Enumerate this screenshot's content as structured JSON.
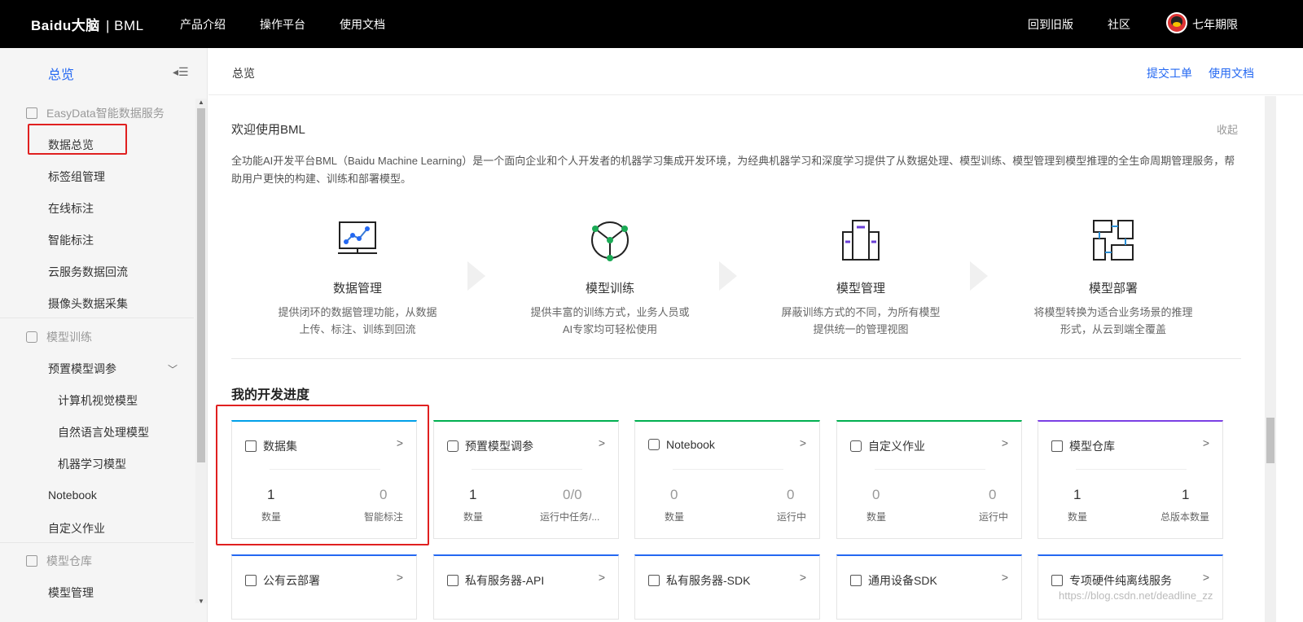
{
  "topbar": {
    "logo_text": "Bai",
    "logo_mid": "du大脑",
    "logo_bml": "| BML",
    "nav": [
      "产品介绍",
      "操作平台",
      "使用文档"
    ],
    "right": [
      "回到旧版",
      "社区"
    ],
    "username": "七年期限"
  },
  "sidebar": {
    "title": "总览",
    "collapse_glyph": "◂☰",
    "groups": {
      "easydata": "EasyData智能数据服务",
      "train": "模型训练",
      "repo": "模型仓库"
    },
    "items": {
      "data_overview": "数据总览",
      "tag_group": "标签组管理",
      "online_label": "在线标注",
      "smart_label": "智能标注",
      "cloud_return": "云服务数据回流",
      "camera": "摄像头数据采集",
      "preset_tune": "预置模型调参",
      "cv_model": "计算机视觉模型",
      "nlp_model": "自然语言处理模型",
      "ml_model": "机器学习模型",
      "notebook": "Notebook",
      "custom_job": "自定义作业",
      "model_mgmt": "模型管理"
    }
  },
  "header": {
    "breadcrumb": "总览",
    "submit_ticket": "提交工单",
    "docs": "使用文档"
  },
  "welcome": {
    "title": "欢迎使用BML",
    "collapse": "收起",
    "description": "全功能AI开发平台BML（Baidu Machine Learning）是一个面向企业和个人开发者的机器学习集成开发环境，为经典机器学习和深度学习提供了从数据处理、模型训练、模型管理到模型推理的全生命周期管理服务，帮助用户更快的构建、训练和部署模型。"
  },
  "features": [
    {
      "title": "数据管理",
      "desc1": "提供闭环的数据管理功能，从数据",
      "desc2": "上传、标注、训练到回流"
    },
    {
      "title": "模型训练",
      "desc1": "提供丰富的训练方式，业务人员或",
      "desc2": "AI专家均可轻松使用"
    },
    {
      "title": "模型管理",
      "desc1": "屏蔽训练方式的不同，为所有模型",
      "desc2": "提供统一的管理视图"
    },
    {
      "title": "模型部署",
      "desc1": "将模型转换为适合业务场景的推理",
      "desc2": "形式，从云到端全覆盖"
    }
  ],
  "progress": {
    "title": "我的开发进度",
    "cards": [
      {
        "name": "数据集",
        "v1": "1",
        "l1": "数量",
        "v2": "0",
        "l2": "智能标注"
      },
      {
        "name": "预置模型调参",
        "v1": "1",
        "l1": "数量",
        "v2": "0/0",
        "l2": "运行中任务/..."
      },
      {
        "name": "Notebook",
        "v1": "0",
        "l1": "数量",
        "v2": "0",
        "l2": "运行中"
      },
      {
        "name": "自定义作业",
        "v1": "0",
        "l1": "数量",
        "v2": "0",
        "l2": "运行中"
      },
      {
        "name": "模型仓库",
        "v1": "1",
        "l1": "数量",
        "v2": "1",
        "l2": "总版本数量"
      }
    ],
    "deploy_cards": [
      "公有云部署",
      "私有服务器-API",
      "私有服务器-SDK",
      "通用设备SDK",
      "专项硬件纯离线服务"
    ]
  },
  "colors": {
    "topbar": "#000000",
    "accent": "#2468f2",
    "card_blue": "#00a0e9",
    "card_green": "#00b050",
    "card_purple": "#7b3fe4",
    "highlight_red": "#e02020"
  },
  "watermark": "https://blog.csdn.net/deadline_zz"
}
